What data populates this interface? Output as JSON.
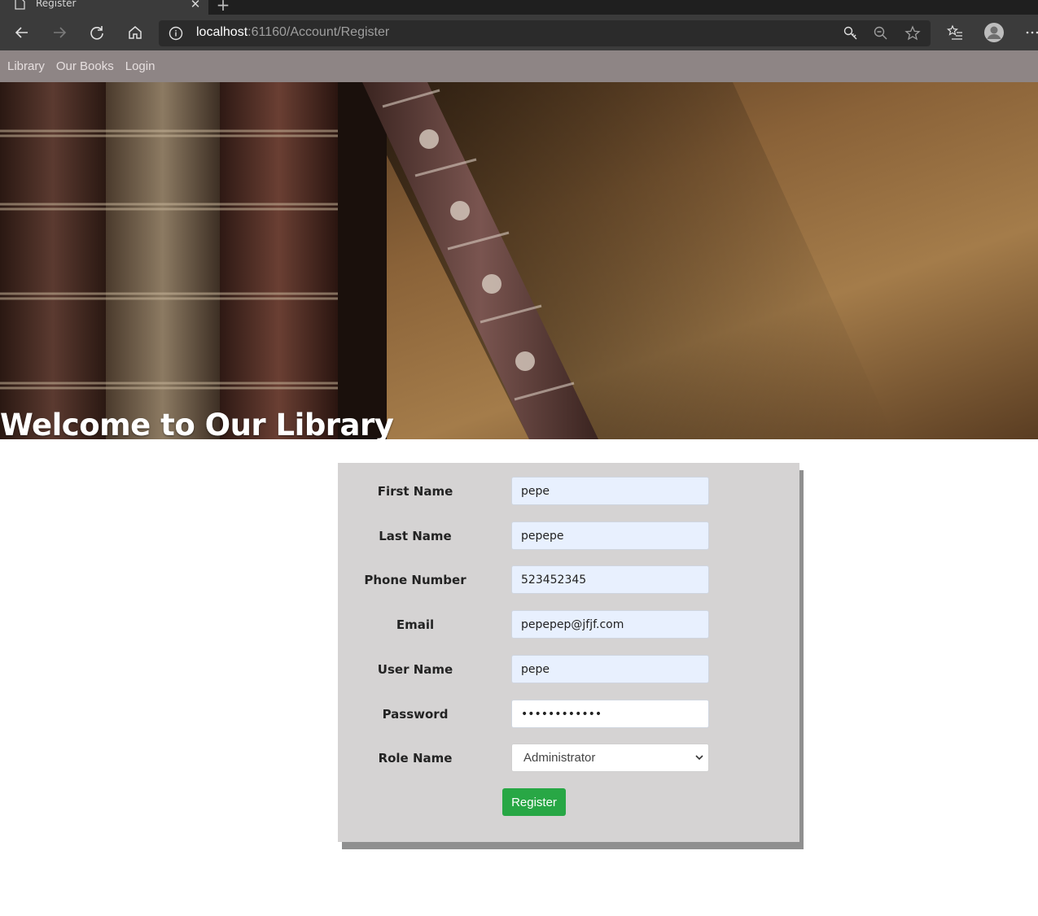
{
  "browser": {
    "tab_title": "Register",
    "url_host": "localhost",
    "url_rest": ":61160/Account/Register"
  },
  "nav": {
    "brand": "Library",
    "items": [
      "Our Books",
      "Login"
    ]
  },
  "hero": {
    "title": "Welcome to Our Library"
  },
  "form": {
    "fields": [
      {
        "label": "First Name",
        "value": "pepe"
      },
      {
        "label": "Last Name",
        "value": "pepepe"
      },
      {
        "label": "Phone Number",
        "value": "523452345"
      },
      {
        "label": "Email",
        "value": "pepepep@jfjf.com"
      },
      {
        "label": "User Name",
        "value": "pepe"
      },
      {
        "label": "Password",
        "value": "••••••••••••"
      },
      {
        "label": "Role Name",
        "value": "Administrator"
      }
    ],
    "submit_label": "Register"
  },
  "colors": {
    "navbar": "#8e8585",
    "card": "#d5d3d3",
    "button": "#28a745",
    "autofill": "#e8f0fe"
  }
}
